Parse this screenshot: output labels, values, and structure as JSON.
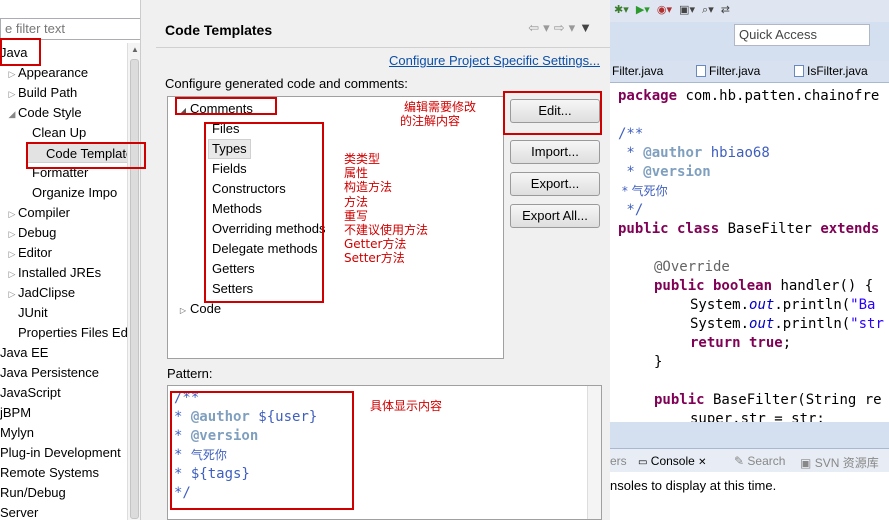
{
  "left_panel": {
    "filter_text": "e filter text",
    "tree": [
      {
        "label": "Java",
        "arrow": "",
        "indent": 0
      },
      {
        "label": "Appearance",
        "arrow": "▷",
        "indent": 1
      },
      {
        "label": "Build Path",
        "arrow": "▷",
        "indent": 1
      },
      {
        "label": "Code Style",
        "arrow": "◢",
        "indent": 1
      },
      {
        "label": "Clean Up",
        "arrow": "",
        "indent": 2
      },
      {
        "label": "Code Template",
        "arrow": "",
        "indent": 2
      },
      {
        "label": "Formatter",
        "arrow": "",
        "indent": 2
      },
      {
        "label": "Organize Impo",
        "arrow": "",
        "indent": 2
      },
      {
        "label": "Compiler",
        "arrow": "▷",
        "indent": 1
      },
      {
        "label": "Debug",
        "arrow": "▷",
        "indent": 1
      },
      {
        "label": "Editor",
        "arrow": "▷",
        "indent": 1
      },
      {
        "label": "Installed JREs",
        "arrow": "▷",
        "indent": 1
      },
      {
        "label": "JadClipse",
        "arrow": "▷",
        "indent": 1
      },
      {
        "label": "JUnit",
        "arrow": "",
        "indent": 1
      },
      {
        "label": "Properties Files Ed",
        "arrow": "",
        "indent": 1
      },
      {
        "label": "Java EE",
        "arrow": "",
        "indent": 0
      },
      {
        "label": "Java Persistence",
        "arrow": "",
        "indent": 0
      },
      {
        "label": "JavaScript",
        "arrow": "",
        "indent": 0
      },
      {
        "label": "jBPM",
        "arrow": "",
        "indent": 0
      },
      {
        "label": "Mylyn",
        "arrow": "",
        "indent": 0
      },
      {
        "label": "Plug-in Development",
        "arrow": "",
        "indent": 0
      },
      {
        "label": "Remote Systems",
        "arrow": "",
        "indent": 0
      },
      {
        "label": "Run/Debug",
        "arrow": "",
        "indent": 0
      },
      {
        "label": "Server",
        "arrow": "",
        "indent": 0
      }
    ]
  },
  "dialog": {
    "title": "Code Templates",
    "project_link": "Configure Project Specific Settings...",
    "configure_label": "Configure generated code and comments:",
    "comments_node": "Comments",
    "comment_items": [
      "Files",
      "Types",
      "Fields",
      "Constructors",
      "Methods",
      "Overriding methods",
      "Delegate methods",
      "Getters",
      "Setters"
    ],
    "code_node": "Code",
    "buttons": {
      "edit": "Edit...",
      "import": "Import...",
      "export": "Export...",
      "export_all": "Export All..."
    },
    "pattern_label": "Pattern:",
    "pattern_lines": {
      "l1": "/**",
      "l2_star": "* ",
      "l2_tag": "@author",
      "l2_val": " ${user}",
      "l3_star": "* ",
      "l3_tag": "@version",
      "l4_star": "* ",
      "l4_text": "气死你",
      "l5": "* ${tags}",
      "l6": "*/"
    }
  },
  "annotations": {
    "edit_note_1": "编辑需要修改",
    "edit_note_2": "的注解内容",
    "types_notes": [
      "类类型",
      "属性",
      "构造方法",
      "方法",
      "重写",
      "不建议使用方法",
      "Getter方法",
      "Setter方法"
    ],
    "pattern_note": "具体显示内容"
  },
  "editor": {
    "quick_access": "Quick Access",
    "tabs": [
      "Filter.java",
      "Filter.java",
      "IsFilter.java"
    ],
    "code": {
      "pkg_kw": "package",
      "pkg_name": " com.hb.patten.chainofre",
      "jd_open": "/**",
      "author_star": " * ",
      "author_tag": "@author",
      "author_val": " hbiao68",
      "version_star": " * ",
      "version_tag": "@version",
      "zh_line": " * 气死你",
      "jd_close": " */",
      "class_kw": "public class",
      "class_name": " BaseFilter ",
      "extends_kw": "extends",
      "override": "@Override",
      "method_kw": "public boolean",
      "method_rest": " handler() {",
      "sys1_pre": "System.",
      "sys1_out": "out",
      "sys1_mid": ".println(",
      "sys1_str": "\"Ba",
      "sys2_pre": "System.",
      "sys2_out": "out",
      "sys2_mid": ".println(",
      "sys2_str": "\"str",
      "ret_kw": "return",
      "ret_val": " true",
      "ret_end": ";",
      "close_brace": "}",
      "ctor_kw": "public",
      "ctor_rest": " BaseFilter(String re",
      "last_line": "super.str = str;"
    },
    "console_tabs": {
      "partial": "ers",
      "console": "Console",
      "search": "Search",
      "svn": "SVN 资源库"
    },
    "console_text": "nsoles to display at this time."
  }
}
